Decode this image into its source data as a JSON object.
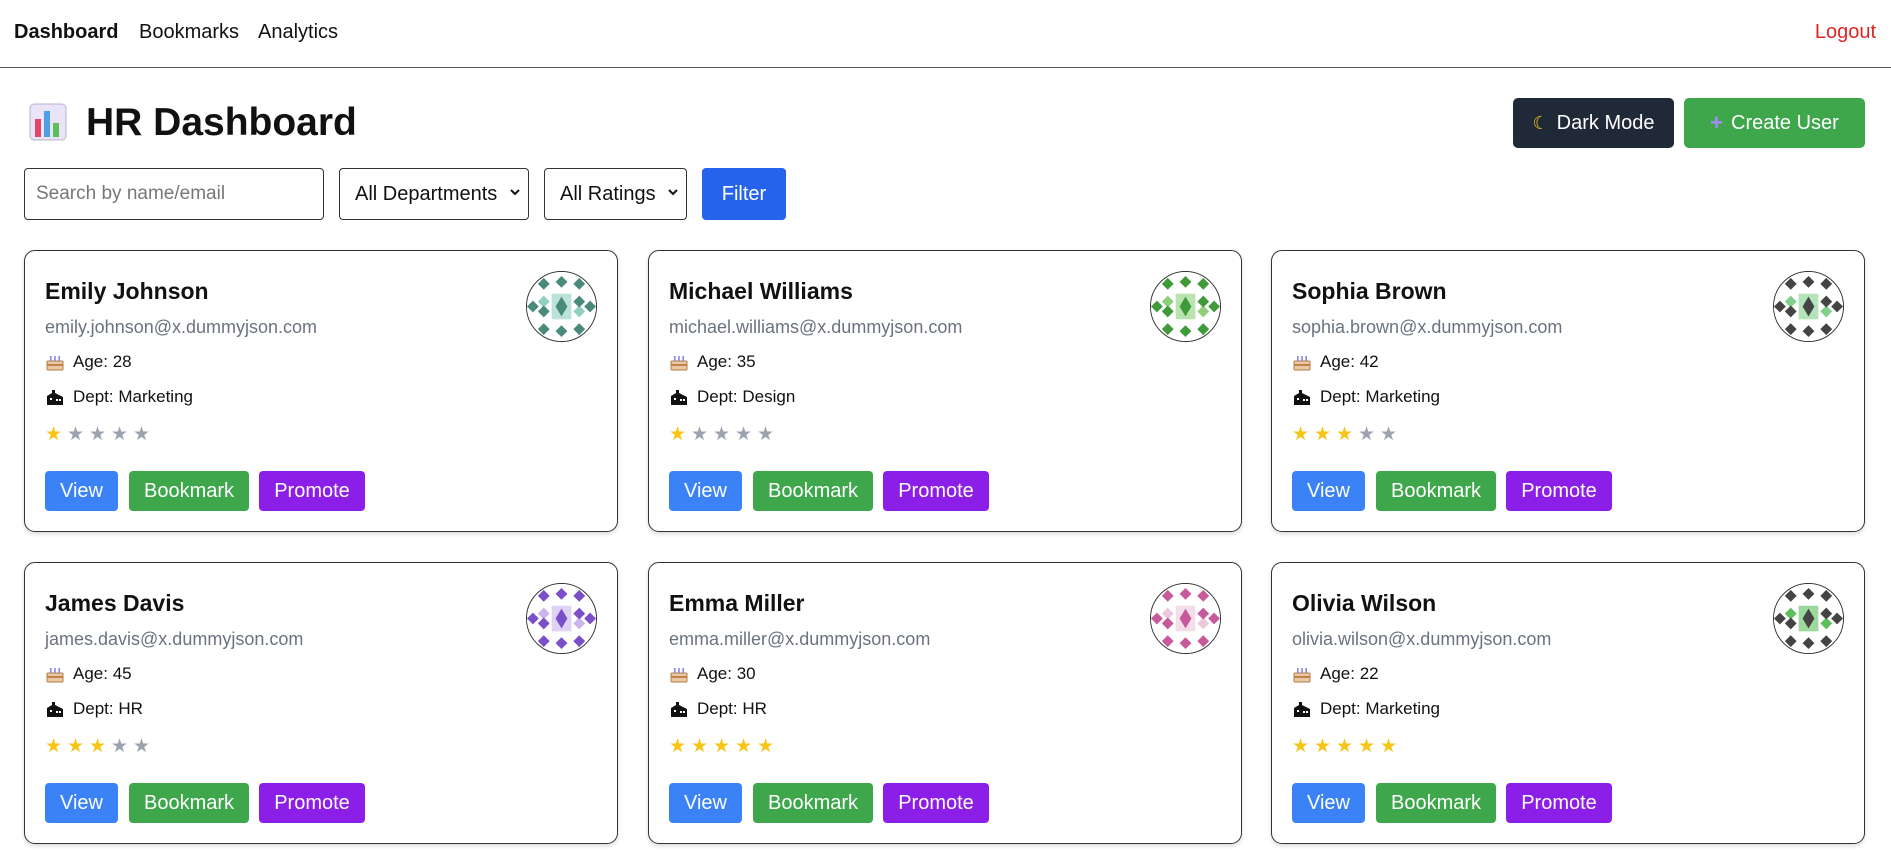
{
  "nav": {
    "links": [
      "Dashboard",
      "Bookmarks",
      "Analytics"
    ],
    "logout": "Logout"
  },
  "header": {
    "title": "HR Dashboard",
    "title_icon": "bar-chart-icon",
    "dark_mode_label": "Dark Mode",
    "dark_mode_icon": "moon-icon",
    "create_user_label": "Create User",
    "create_user_icon": "plus-icon"
  },
  "filters": {
    "search_placeholder": "Search by name/email",
    "department_selected": "All Departments",
    "rating_selected": "All Ratings",
    "filter_label": "Filter"
  },
  "labels": {
    "age_prefix": "Age: ",
    "dept_prefix": "Dept: ",
    "view": "View",
    "bookmark": "Bookmark",
    "promote": "Promote"
  },
  "colors": {
    "primary_blue": "#2563eb",
    "view_blue": "#3b82f6",
    "green": "#3ea64b",
    "purple": "#8b1fe8",
    "dark": "#1f2937",
    "logout_red": "#dc2626",
    "star_on": "#f5c518",
    "star_off": "#9ca3af"
  },
  "users": [
    {
      "name": "Emily Johnson",
      "email": "emily.johnson@x.dummyjson.com",
      "age": "28",
      "dept": "Marketing",
      "rating": 1,
      "avatar_color": "#4a8a7a",
      "avatar_accent": "#8fd0c0"
    },
    {
      "name": "Michael Williams",
      "email": "michael.williams@x.dummyjson.com",
      "age": "35",
      "dept": "Design",
      "rating": 1,
      "avatar_color": "#3f9a3a",
      "avatar_accent": "#8ed07a"
    },
    {
      "name": "Sophia Brown",
      "email": "sophia.brown@x.dummyjson.com",
      "age": "42",
      "dept": "Marketing",
      "rating": 3,
      "avatar_color": "#444444",
      "avatar_accent": "#7fd08a"
    },
    {
      "name": "James Davis",
      "email": "james.davis@x.dummyjson.com",
      "age": "45",
      "dept": "HR",
      "rating": 3,
      "avatar_color": "#7b4fc9",
      "avatar_accent": "#c9b4ee"
    },
    {
      "name": "Emma Miller",
      "email": "emma.miller@x.dummyjson.com",
      "age": "30",
      "dept": "HR",
      "rating": 5,
      "avatar_color": "#c65a9a",
      "avatar_accent": "#edc8dc"
    },
    {
      "name": "Olivia Wilson",
      "email": "olivia.wilson@x.dummyjson.com",
      "age": "22",
      "dept": "Marketing",
      "rating": 5,
      "avatar_color": "#444444",
      "avatar_accent": "#5cbf5a"
    }
  ]
}
